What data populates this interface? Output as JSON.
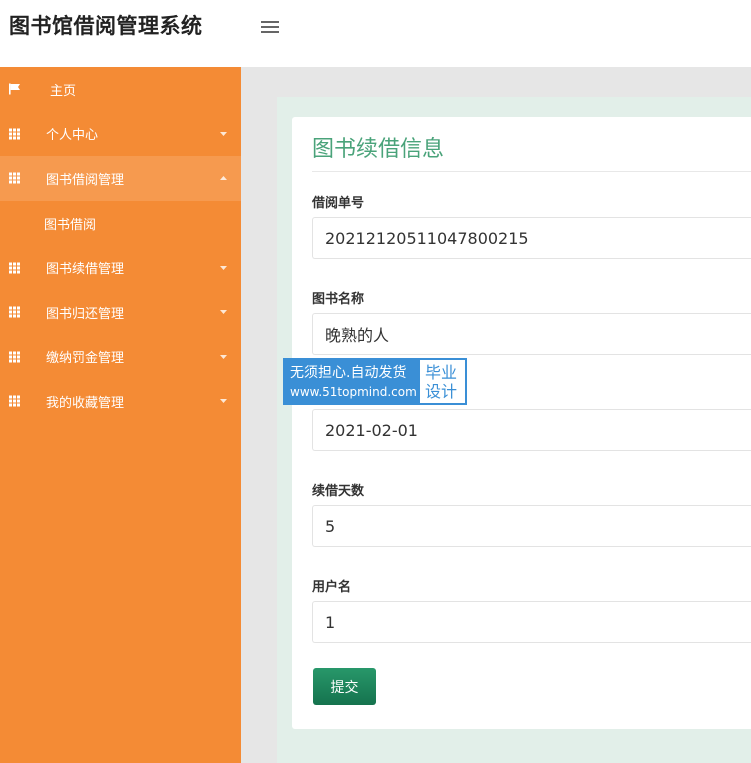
{
  "app": {
    "title": "图书馆借阅管理系统"
  },
  "sidebar": {
    "items": [
      {
        "label": "主页"
      },
      {
        "label": "个人中心"
      },
      {
        "label": "图书借阅管理"
      },
      {
        "label": "图书借阅"
      },
      {
        "label": "图书续借管理"
      },
      {
        "label": "图书归还管理"
      },
      {
        "label": "缴纳罚金管理"
      },
      {
        "label": "我的收藏管理"
      }
    ]
  },
  "form": {
    "title": "图书续借信息",
    "fields": [
      {
        "label": "借阅单号",
        "value": "20212120511047800215"
      },
      {
        "label": "图书名称",
        "value": "晚熟的人"
      },
      {
        "label": "",
        "value": "2021-02-01"
      },
      {
        "label": "续借天数",
        "value": "5"
      },
      {
        "label": "用户名",
        "value": "1"
      }
    ],
    "submit_label": "提交"
  },
  "watermark": {
    "line1": "无须担心.自动发货",
    "line2": "www.51topmind.com",
    "right_top": "毕业",
    "right_bottom": "设计"
  },
  "colors": {
    "sidebar": "#f48b35",
    "sidebar_active": "#f69a4f",
    "accent_green": "#4aa37a",
    "button": "#1f8a5f",
    "watermark_blue": "#3a8fd6"
  },
  "icons": {
    "home": "flag-icon",
    "menu": "grid-icon",
    "toggle": "hamburger-icon"
  }
}
